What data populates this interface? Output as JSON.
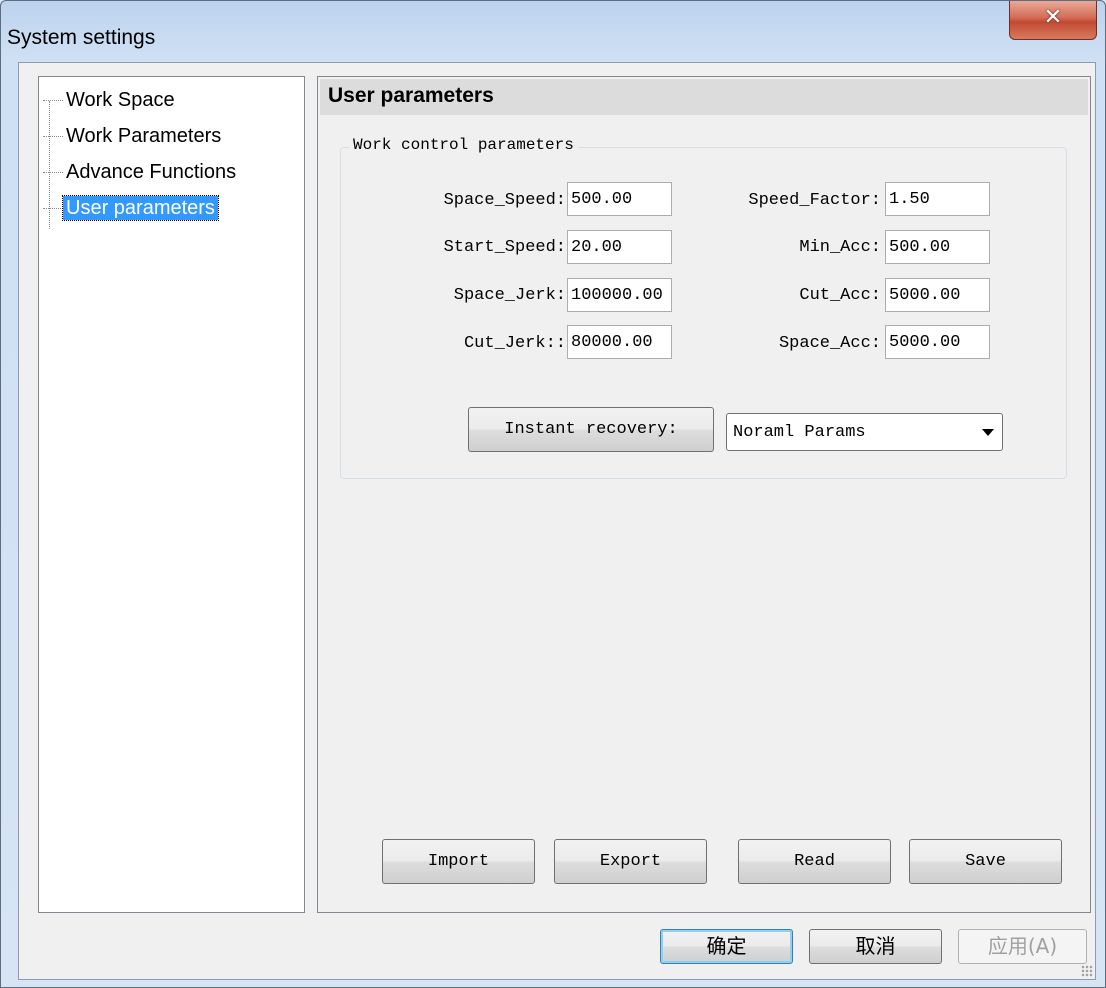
{
  "window": {
    "title": "System settings",
    "close_glyph": "✕"
  },
  "tree": {
    "items": [
      {
        "label": "Work Space"
      },
      {
        "label": "Work Parameters"
      },
      {
        "label": "Advance Functions"
      },
      {
        "label": "User parameters",
        "selected": true
      }
    ]
  },
  "panel": {
    "title": "User parameters",
    "group_label": "Work control parameters",
    "params_left": [
      {
        "label": "Space_Speed:",
        "value": "500.00"
      },
      {
        "label": "Start_Speed:",
        "value": "20.00"
      },
      {
        "label": "Space_Jerk:",
        "value": "100000.00"
      },
      {
        "label": "Cut_Jerk::",
        "value": "80000.00"
      }
    ],
    "params_right": [
      {
        "label": "Speed_Factor:",
        "value": "1.50"
      },
      {
        "label": "Min_Acc:",
        "value": "500.00"
      },
      {
        "label": "Cut_Acc:",
        "value": "5000.00"
      },
      {
        "label": "Space_Acc:",
        "value": "5000.00"
      }
    ],
    "instant_recovery_label": "Instant recovery:",
    "recovery_select": {
      "selected": "Noraml Params"
    },
    "actions": {
      "import": "Import",
      "export": "Export",
      "read": "Read",
      "save": "Save"
    }
  },
  "dialog_buttons": {
    "ok": "确定",
    "cancel": "取消",
    "apply": "应用(A)"
  },
  "colors": {
    "selection": "#3399ff",
    "close_button": "#c9503a"
  }
}
